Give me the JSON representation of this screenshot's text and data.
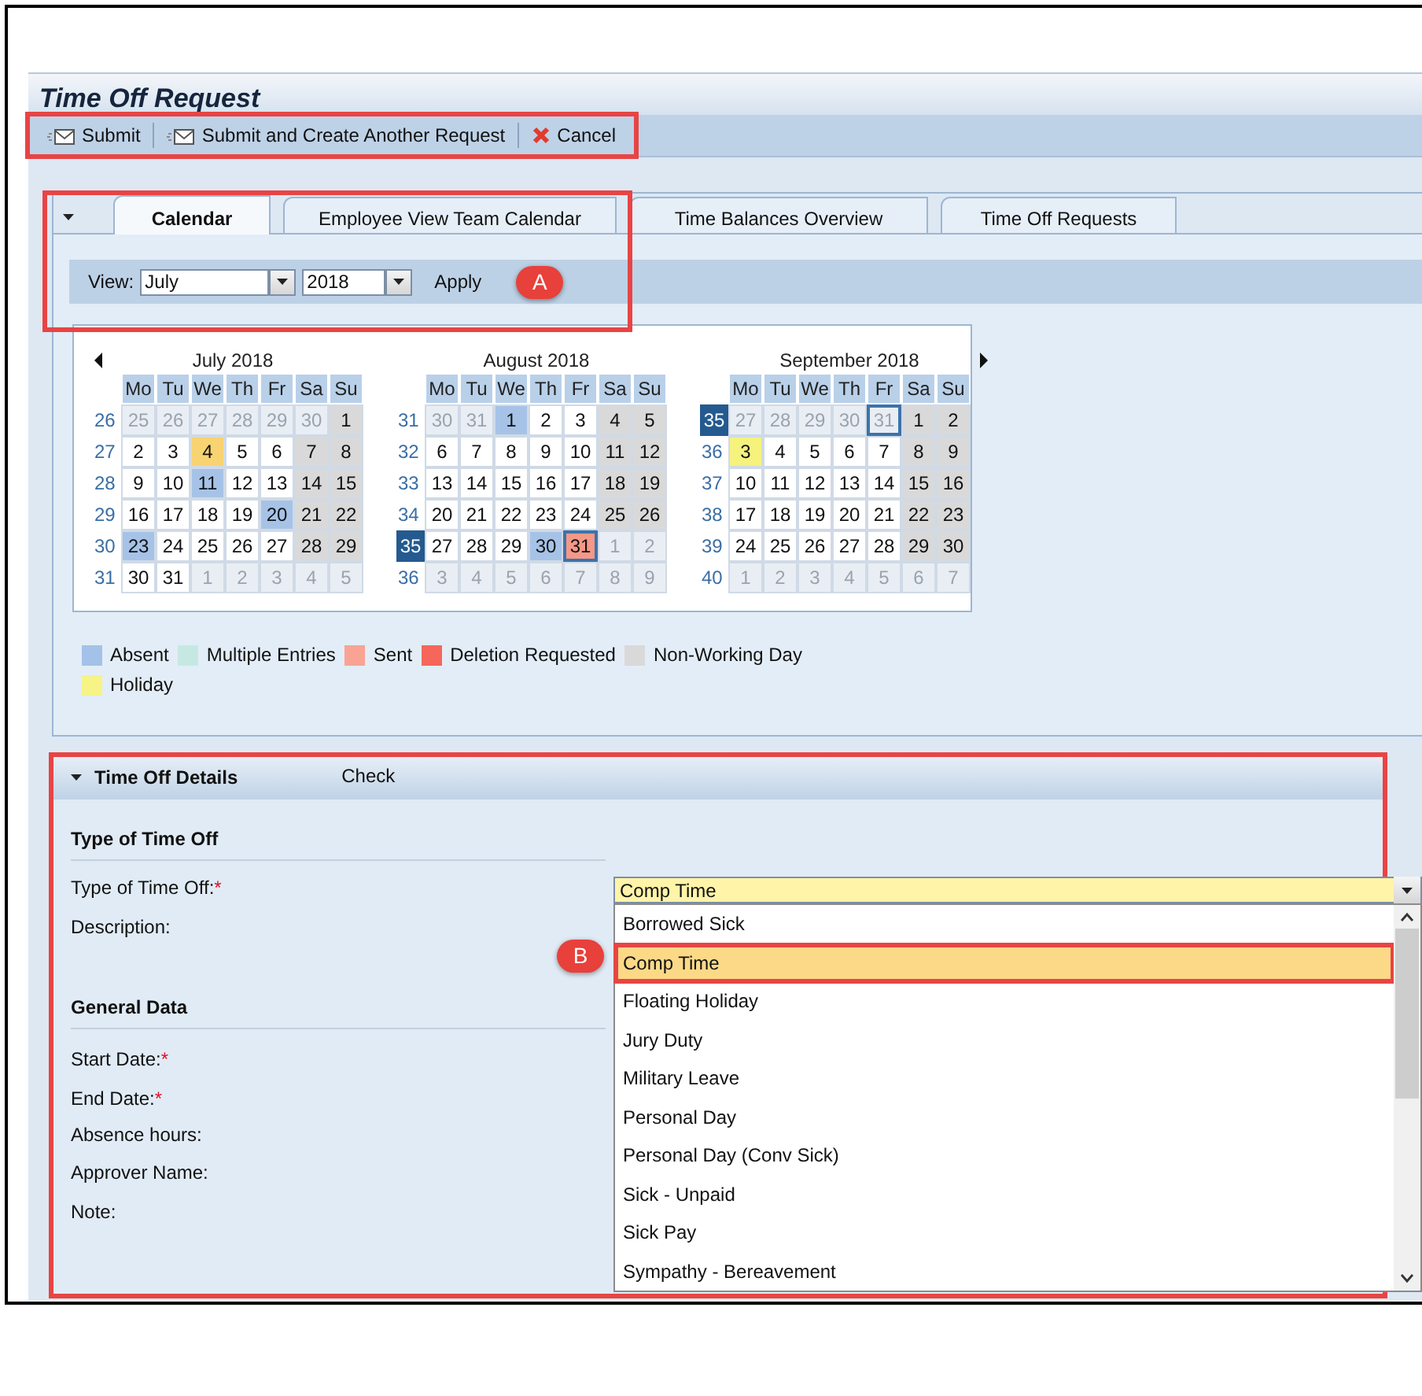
{
  "page": {
    "title": "Time Off Request"
  },
  "toolbar": [
    {
      "label": "Submit",
      "kind": "send"
    },
    {
      "label": "Submit and Create Another Request",
      "kind": "send"
    },
    {
      "label": "Cancel",
      "kind": "cancel"
    }
  ],
  "tabs": [
    {
      "label": "Calendar",
      "selected": true
    },
    {
      "label": "Employee View Team Calendar",
      "selected": false
    },
    {
      "label": "Time Balances Overview",
      "selected": false
    },
    {
      "label": "Time Off Requests",
      "selected": false
    }
  ],
  "view_bar": {
    "label": "View:",
    "month": "July",
    "year": "2018",
    "apply": "Apply",
    "callout": "A"
  },
  "calendar": {
    "months": [
      {
        "title": "July 2018",
        "weekdays": [
          "Mo",
          "Tu",
          "We",
          "Th",
          "Fr",
          "Sa",
          "Su"
        ],
        "weeks": [
          {
            "number": "26",
            "selected": false,
            "days": [
              {
                "d": "25",
                "kind": "out",
                "selected": false
              },
              {
                "d": "26",
                "kind": "out",
                "selected": false
              },
              {
                "d": "27",
                "kind": "out",
                "selected": false
              },
              {
                "d": "28",
                "kind": "out",
                "selected": false
              },
              {
                "d": "29",
                "kind": "out",
                "selected": false
              },
              {
                "d": "30",
                "kind": "out",
                "selected": false
              },
              {
                "d": "1",
                "kind": "off",
                "selected": false
              }
            ]
          },
          {
            "number": "27",
            "selected": false,
            "days": [
              {
                "d": "2",
                "kind": "work",
                "selected": false
              },
              {
                "d": "3",
                "kind": "work",
                "selected": false
              },
              {
                "d": "4",
                "kind": "today",
                "selected": false
              },
              {
                "d": "5",
                "kind": "work",
                "selected": false
              },
              {
                "d": "6",
                "kind": "work",
                "selected": false
              },
              {
                "d": "7",
                "kind": "off",
                "selected": false
              },
              {
                "d": "8",
                "kind": "off",
                "selected": false
              }
            ]
          },
          {
            "number": "28",
            "selected": false,
            "days": [
              {
                "d": "9",
                "kind": "work",
                "selected": false
              },
              {
                "d": "10",
                "kind": "work",
                "selected": false
              },
              {
                "d": "11",
                "kind": "absent",
                "selected": false
              },
              {
                "d": "12",
                "kind": "work",
                "selected": false
              },
              {
                "d": "13",
                "kind": "work",
                "selected": false
              },
              {
                "d": "14",
                "kind": "off",
                "selected": false
              },
              {
                "d": "15",
                "kind": "off",
                "selected": false
              }
            ]
          },
          {
            "number": "29",
            "selected": false,
            "days": [
              {
                "d": "16",
                "kind": "work",
                "selected": false
              },
              {
                "d": "17",
                "kind": "work",
                "selected": false
              },
              {
                "d": "18",
                "kind": "work",
                "selected": false
              },
              {
                "d": "19",
                "kind": "work",
                "selected": false
              },
              {
                "d": "20",
                "kind": "absent",
                "selected": false
              },
              {
                "d": "21",
                "kind": "off",
                "selected": false
              },
              {
                "d": "22",
                "kind": "off",
                "selected": false
              }
            ]
          },
          {
            "number": "30",
            "selected": false,
            "days": [
              {
                "d": "23",
                "kind": "absent",
                "selected": false
              },
              {
                "d": "24",
                "kind": "work",
                "selected": false
              },
              {
                "d": "25",
                "kind": "work",
                "selected": false
              },
              {
                "d": "26",
                "kind": "work",
                "selected": false
              },
              {
                "d": "27",
                "kind": "work",
                "selected": false
              },
              {
                "d": "28",
                "kind": "off",
                "selected": false
              },
              {
                "d": "29",
                "kind": "off",
                "selected": false
              }
            ]
          },
          {
            "number": "31",
            "selected": false,
            "days": [
              {
                "d": "30",
                "kind": "work",
                "selected": false
              },
              {
                "d": "31",
                "kind": "work",
                "selected": false
              },
              {
                "d": "1",
                "kind": "out",
                "selected": false
              },
              {
                "d": "2",
                "kind": "out",
                "selected": false
              },
              {
                "d": "3",
                "kind": "out",
                "selected": false
              },
              {
                "d": "4",
                "kind": "out",
                "selected": false
              },
              {
                "d": "5",
                "kind": "out",
                "selected": false
              }
            ]
          }
        ]
      },
      {
        "title": "August 2018",
        "weekdays": [
          "Mo",
          "Tu",
          "We",
          "Th",
          "Fr",
          "Sa",
          "Su"
        ],
        "weeks": [
          {
            "number": "31",
            "selected": false,
            "days": [
              {
                "d": "30",
                "kind": "out",
                "selected": false
              },
              {
                "d": "31",
                "kind": "out",
                "selected": false
              },
              {
                "d": "1",
                "kind": "absent",
                "selected": false
              },
              {
                "d": "2",
                "kind": "work",
                "selected": false
              },
              {
                "d": "3",
                "kind": "work",
                "selected": false
              },
              {
                "d": "4",
                "kind": "off",
                "selected": false
              },
              {
                "d": "5",
                "kind": "off",
                "selected": false
              }
            ]
          },
          {
            "number": "32",
            "selected": false,
            "days": [
              {
                "d": "6",
                "kind": "work",
                "selected": false
              },
              {
                "d": "7",
                "kind": "work",
                "selected": false
              },
              {
                "d": "8",
                "kind": "work",
                "selected": false
              },
              {
                "d": "9",
                "kind": "work",
                "selected": false
              },
              {
                "d": "10",
                "kind": "work",
                "selected": false
              },
              {
                "d": "11",
                "kind": "off",
                "selected": false
              },
              {
                "d": "12",
                "kind": "off",
                "selected": false
              }
            ]
          },
          {
            "number": "33",
            "selected": false,
            "days": [
              {
                "d": "13",
                "kind": "work",
                "selected": false
              },
              {
                "d": "14",
                "kind": "work",
                "selected": false
              },
              {
                "d": "15",
                "kind": "work",
                "selected": false
              },
              {
                "d": "16",
                "kind": "work",
                "selected": false
              },
              {
                "d": "17",
                "kind": "work",
                "selected": false
              },
              {
                "d": "18",
                "kind": "off",
                "selected": false
              },
              {
                "d": "19",
                "kind": "off",
                "selected": false
              }
            ]
          },
          {
            "number": "34",
            "selected": false,
            "days": [
              {
                "d": "20",
                "kind": "work",
                "selected": false
              },
              {
                "d": "21",
                "kind": "work",
                "selected": false
              },
              {
                "d": "22",
                "kind": "work",
                "selected": false
              },
              {
                "d": "23",
                "kind": "work",
                "selected": false
              },
              {
                "d": "24",
                "kind": "work",
                "selected": false
              },
              {
                "d": "25",
                "kind": "off",
                "selected": false
              },
              {
                "d": "26",
                "kind": "off",
                "selected": false
              }
            ]
          },
          {
            "number": "35",
            "selected": true,
            "days": [
              {
                "d": "27",
                "kind": "work",
                "selected": false
              },
              {
                "d": "28",
                "kind": "work",
                "selected": false
              },
              {
                "d": "29",
                "kind": "work",
                "selected": false
              },
              {
                "d": "30",
                "kind": "absent",
                "selected": false
              },
              {
                "d": "31",
                "kind": "sent",
                "selected": true
              },
              {
                "d": "1",
                "kind": "out",
                "selected": false
              },
              {
                "d": "2",
                "kind": "out",
                "selected": false
              }
            ]
          },
          {
            "number": "36",
            "selected": false,
            "days": [
              {
                "d": "3",
                "kind": "out",
                "selected": false
              },
              {
                "d": "4",
                "kind": "out",
                "selected": false
              },
              {
                "d": "5",
                "kind": "out",
                "selected": false
              },
              {
                "d": "6",
                "kind": "out",
                "selected": false
              },
              {
                "d": "7",
                "kind": "out",
                "selected": false
              },
              {
                "d": "8",
                "kind": "out",
                "selected": false
              },
              {
                "d": "9",
                "kind": "out",
                "selected": false
              }
            ]
          }
        ]
      },
      {
        "title": "September 2018",
        "weekdays": [
          "Mo",
          "Tu",
          "We",
          "Th",
          "Fr",
          "Sa",
          "Su"
        ],
        "weeks": [
          {
            "number": "35",
            "selected": true,
            "days": [
              {
                "d": "27",
                "kind": "out",
                "selected": false
              },
              {
                "d": "28",
                "kind": "out",
                "selected": false
              },
              {
                "d": "29",
                "kind": "out",
                "selected": false
              },
              {
                "d": "30",
                "kind": "out",
                "selected": false
              },
              {
                "d": "31",
                "kind": "out",
                "selected": true
              },
              {
                "d": "1",
                "kind": "off",
                "selected": false
              },
              {
                "d": "2",
                "kind": "off",
                "selected": false
              }
            ]
          },
          {
            "number": "36",
            "selected": false,
            "days": [
              {
                "d": "3",
                "kind": "holiday",
                "selected": false
              },
              {
                "d": "4",
                "kind": "work",
                "selected": false
              },
              {
                "d": "5",
                "kind": "work",
                "selected": false
              },
              {
                "d": "6",
                "kind": "work",
                "selected": false
              },
              {
                "d": "7",
                "kind": "work",
                "selected": false
              },
              {
                "d": "8",
                "kind": "off",
                "selected": false
              },
              {
                "d": "9",
                "kind": "off",
                "selected": false
              }
            ]
          },
          {
            "number": "37",
            "selected": false,
            "days": [
              {
                "d": "10",
                "kind": "work",
                "selected": false
              },
              {
                "d": "11",
                "kind": "work",
                "selected": false
              },
              {
                "d": "12",
                "kind": "work",
                "selected": false
              },
              {
                "d": "13",
                "kind": "work",
                "selected": false
              },
              {
                "d": "14",
                "kind": "work",
                "selected": false
              },
              {
                "d": "15",
                "kind": "off",
                "selected": false
              },
              {
                "d": "16",
                "kind": "off",
                "selected": false
              }
            ]
          },
          {
            "number": "38",
            "selected": false,
            "days": [
              {
                "d": "17",
                "kind": "work",
                "selected": false
              },
              {
                "d": "18",
                "kind": "work",
                "selected": false
              },
              {
                "d": "19",
                "kind": "work",
                "selected": false
              },
              {
                "d": "20",
                "kind": "work",
                "selected": false
              },
              {
                "d": "21",
                "kind": "work",
                "selected": false
              },
              {
                "d": "22",
                "kind": "off",
                "selected": false
              },
              {
                "d": "23",
                "kind": "off",
                "selected": false
              }
            ]
          },
          {
            "number": "39",
            "selected": false,
            "days": [
              {
                "d": "24",
                "kind": "work",
                "selected": false
              },
              {
                "d": "25",
                "kind": "work",
                "selected": false
              },
              {
                "d": "26",
                "kind": "work",
                "selected": false
              },
              {
                "d": "27",
                "kind": "work",
                "selected": false
              },
              {
                "d": "28",
                "kind": "work",
                "selected": false
              },
              {
                "d": "29",
                "kind": "off",
                "selected": false
              },
              {
                "d": "30",
                "kind": "off",
                "selected": false
              }
            ]
          },
          {
            "number": "40",
            "selected": false,
            "days": [
              {
                "d": "1",
                "kind": "out",
                "selected": false
              },
              {
                "d": "2",
                "kind": "out",
                "selected": false
              },
              {
                "d": "3",
                "kind": "out",
                "selected": false
              },
              {
                "d": "4",
                "kind": "out",
                "selected": false
              },
              {
                "d": "5",
                "kind": "out",
                "selected": false
              },
              {
                "d": "6",
                "kind": "out",
                "selected": false
              },
              {
                "d": "7",
                "kind": "out",
                "selected": false
              }
            ]
          }
        ]
      }
    ]
  },
  "legend": [
    {
      "label": "Absent",
      "color": "#a4c2e8"
    },
    {
      "label": "Multiple Entries",
      "color": "#c6e8e3"
    },
    {
      "label": "Sent",
      "color": "#f9a394"
    },
    {
      "label": "Deletion Requested",
      "color": "#f4675a"
    },
    {
      "label": "Non-Working Day",
      "color": "#d9d9d9"
    },
    {
      "label": "Holiday",
      "color": "#f6f387"
    }
  ],
  "details": {
    "title": "Time Off Details",
    "check": "Check",
    "sections": [
      {
        "heading": "Type of Time Off",
        "fields": [
          {
            "label": "Type of Time Off:",
            "required_mark": "*"
          },
          {
            "label": "Description:"
          }
        ]
      },
      {
        "heading": "General Data",
        "fields": [
          {
            "label": "Start Date:",
            "required_mark": "*"
          },
          {
            "label": "End Date:",
            "required_mark": "*"
          },
          {
            "label": "Absence hours:"
          },
          {
            "label": "Approver Name:"
          },
          {
            "label": "Note:"
          }
        ]
      }
    ]
  },
  "dropdown": {
    "value": "Comp Time",
    "callout": "B",
    "options": [
      {
        "label": "Borrowed Sick",
        "selected": false
      },
      {
        "label": "Comp Time",
        "selected": true
      },
      {
        "label": "Floating Holiday",
        "selected": false
      },
      {
        "label": "Jury Duty",
        "selected": false
      },
      {
        "label": "Military Leave",
        "selected": false
      },
      {
        "label": "Personal Day",
        "selected": false
      },
      {
        "label": "Personal Day (Conv Sick)",
        "selected": false
      },
      {
        "label": "Sick - Unpaid",
        "selected": false
      },
      {
        "label": "Sick Pay",
        "selected": false
      },
      {
        "label": "Sympathy - Bereavement",
        "selected": false
      }
    ]
  }
}
